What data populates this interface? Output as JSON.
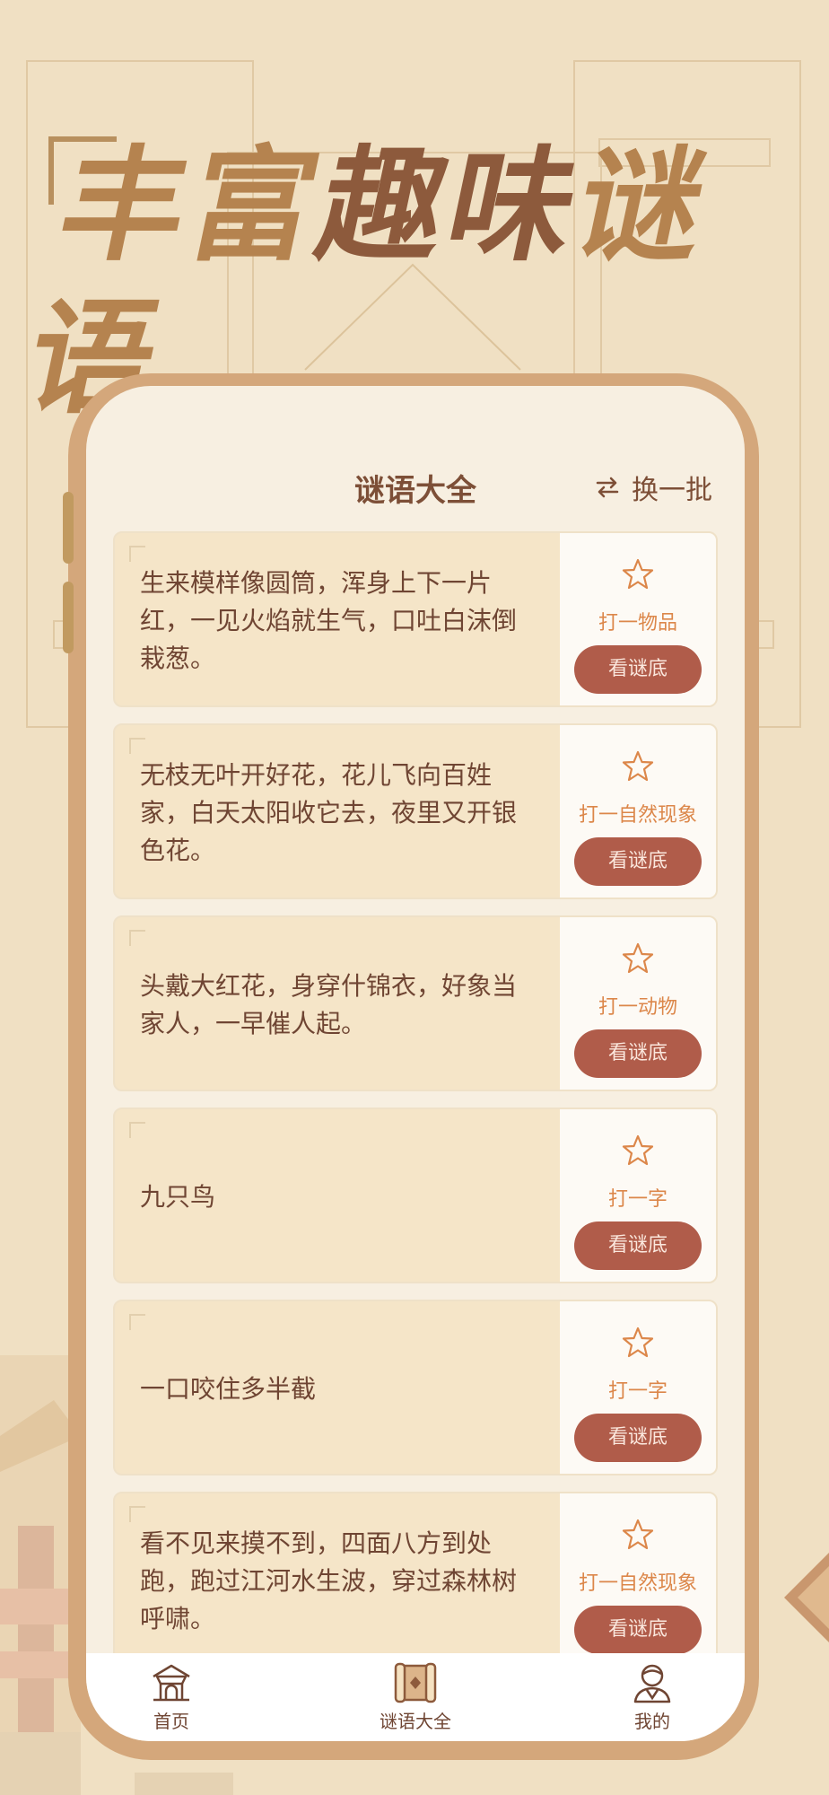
{
  "hero": {
    "title_a": "丰富",
    "title_b": "趣味",
    "title_c": "谜语"
  },
  "header": {
    "title": "谜语大全",
    "refresh_label": "换一批"
  },
  "riddles": [
    {
      "text": "生来模样像圆筒，浑身上下一片红，一见火焰就生气，口吐白沫倒栽葱。",
      "category": "打一物品",
      "button": "看谜底"
    },
    {
      "text": "无枝无叶开好花，花儿飞向百姓家，白天太阳收它去，夜里又开银色花。",
      "category": "打一自然现象",
      "button": "看谜底"
    },
    {
      "text": "头戴大红花，身穿什锦衣，好象当家人，一早催人起。",
      "category": "打一动物",
      "button": "看谜底"
    },
    {
      "text": "九只鸟",
      "category": "打一字",
      "button": "看谜底"
    },
    {
      "text": "一口咬住多半截",
      "category": "打一字",
      "button": "看谜底"
    },
    {
      "text": "看不见来摸不到，四面八方到处跑，跑过江河水生波，穿过森林树呼啸。",
      "category": "打一自然现象",
      "button": "看谜底"
    }
  ],
  "tabbar": {
    "home": "首页",
    "riddles": "谜语大全",
    "mine": "我的"
  },
  "colors": {
    "background": "#f0e0c3",
    "hero": "#b5834f",
    "hero_mid": "#8d5a3c",
    "button": "#b05c4a",
    "category": "#dc874a",
    "text": "#6f4533"
  },
  "icons": {
    "refresh": "swap-arrows-icon",
    "favorite": "star-outline-icon",
    "home": "temple-icon",
    "riddles": "scroll-icon",
    "mine": "user-icon"
  }
}
